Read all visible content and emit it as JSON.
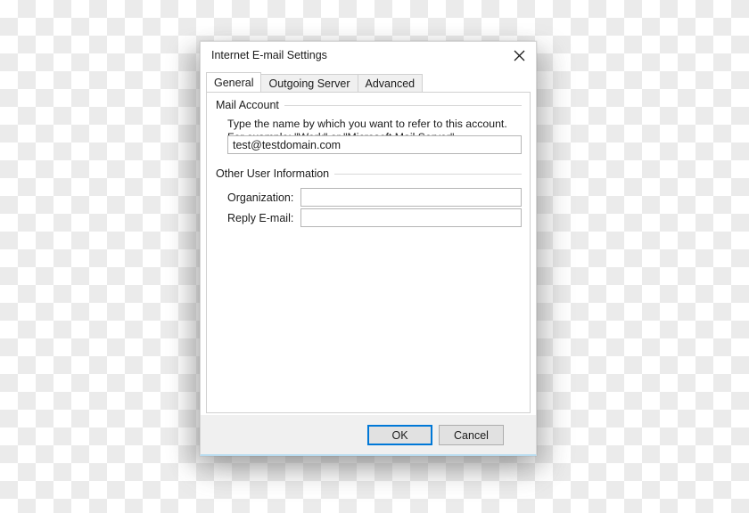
{
  "dialog": {
    "title": "Internet E-mail Settings",
    "close_icon": "close-icon"
  },
  "tabs": [
    {
      "label": "General",
      "selected": true
    },
    {
      "label": "Outgoing Server",
      "selected": false
    },
    {
      "label": "Advanced",
      "selected": false
    }
  ],
  "general_tab": {
    "mail_account": {
      "group_title": "Mail Account",
      "helper_text": "Type the name by which you want to refer to this account. For example: \"Work\" or \"Microsoft Mail Server\"",
      "account_name_value": "test@testdomain.com",
      "account_name_placeholder": ""
    },
    "other_user_information": {
      "group_title": "Other User Information",
      "fields": [
        {
          "label": "Organization:",
          "value": "",
          "placeholder": ""
        },
        {
          "label": "Reply E-mail:",
          "value": "",
          "placeholder": ""
        }
      ]
    }
  },
  "footer": {
    "ok_label": "OK",
    "cancel_label": "Cancel"
  },
  "colors": {
    "accent_focus": "#0078d7",
    "dialog_bg": "#ffffff",
    "footer_bg": "#f0f0f0",
    "tab_inactive_bg": "#f0f0f0",
    "border": "#d0d0d0",
    "bottom_accent": "#b9dcf0",
    "text": "#1b1b1b"
  }
}
